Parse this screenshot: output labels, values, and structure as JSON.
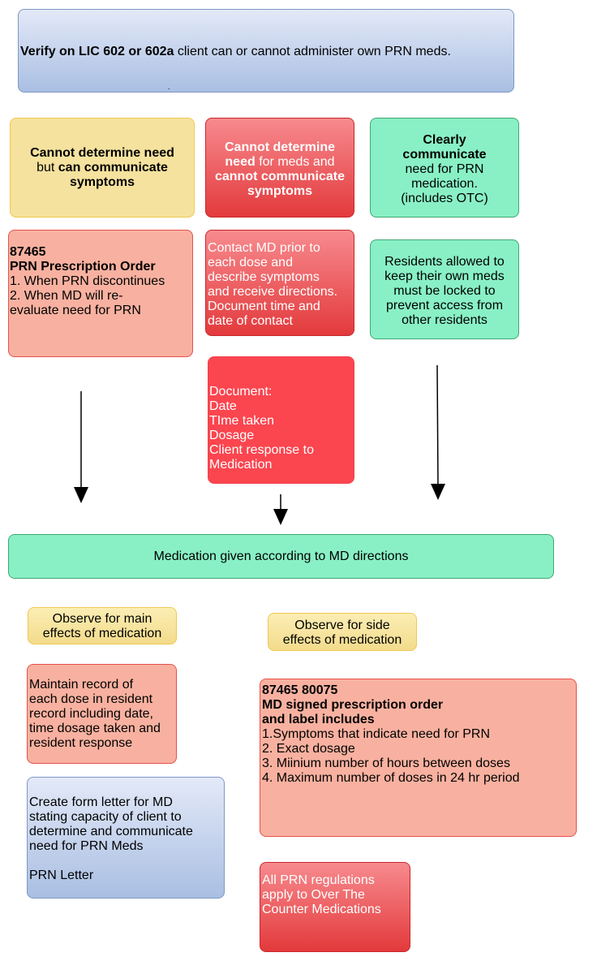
{
  "diagram": {
    "top": {
      "bold": "Verify on LIC 602 or 602a",
      "rest": " client can or cannot administer own PRN meds.",
      "dot": "."
    },
    "columns": [
      {
        "header": {
          "p1_bold": "Cannot determine need",
          "p2": "but ",
          "p3_bold": "can communicate",
          "p4_bold": "symptoms"
        },
        "detail": {
          "code": "87465",
          "title": "PRN Prescription Order",
          "items": [
            "1. When PRN discontinues",
            "2. When MD  will re-",
            "evaluate need for PRN"
          ]
        }
      },
      {
        "header": {
          "p1_bold": "Cannot determine",
          "p2_bold": "need",
          "p3": " for meds and",
          "p4_bold": "cannot communicate",
          "p5_bold": "symptoms"
        },
        "detail": {
          "lines": [
            "Contact MD prior to",
            "each dose and",
            "describe symptoms",
            "and receive directions.",
            "Document time and",
            "date of contact"
          ]
        },
        "document": {
          "lines": [
            "Document:",
            "Date",
            "TIme taken",
            "Dosage",
            "Client response to",
            "Medication"
          ]
        }
      },
      {
        "header": {
          "p1_bold": "Clearly",
          "p2_bold": "communicate",
          "p3": "need for PRN",
          "p4": "medication.",
          "p5": "(includes OTC)"
        },
        "detail": {
          "lines": [
            "Residents allowed to",
            "keep their own meds",
            "must be locked to",
            "prevent access from",
            "other residents"
          ]
        }
      }
    ],
    "given": "Medication  given according to MD directions",
    "observe_main": [
      "Observe for main",
      "effects of medication"
    ],
    "observe_side": [
      "Observe for side",
      "effects of medication"
    ],
    "maintain_record": [
      "Maintain record of",
      "each dose in resident",
      "record including date,",
      "time dosage taken and",
      "resident response"
    ],
    "form_letter": {
      "lines": [
        "Create form letter for MD",
        "stating capacity of client to",
        "determine and communicate",
        "need for PRN Meds"
      ],
      "link": "PRN Letter"
    },
    "prescription": {
      "codes": "87465  80075",
      "title1": "MD signed prescription order",
      "title2": "and label  includes",
      "items": [
        "1.Symptoms that indicate need for PRN",
        "2. Exact dosage",
        "3. Miinium number of hours between doses",
        "4. Maximum number of doses in 24 hr period"
      ]
    },
    "otc": [
      "All PRN regulations",
      "apply to Over The",
      "Counter Medications"
    ]
  }
}
